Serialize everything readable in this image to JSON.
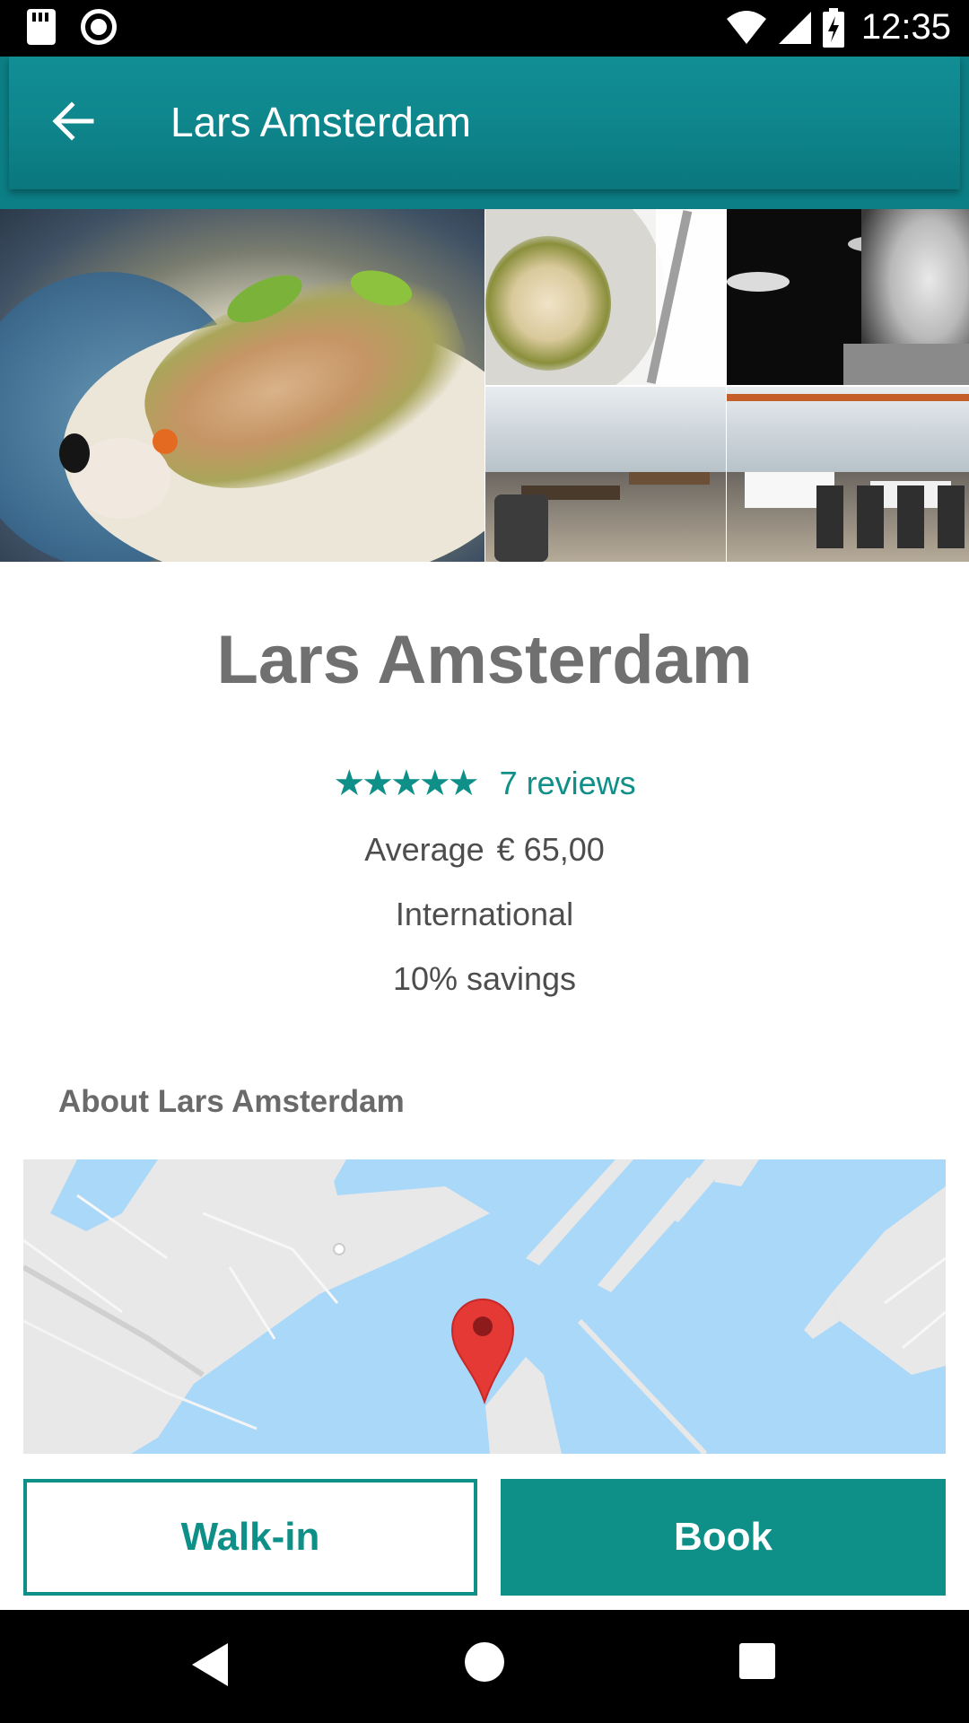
{
  "status_bar": {
    "time": "12:35",
    "icons": [
      "sd-card-icon",
      "record-icon",
      "wifi-icon",
      "signal-icon",
      "battery-charging-icon"
    ]
  },
  "app_bar": {
    "title": "Lars Amsterdam",
    "back_icon": "arrow-left-icon"
  },
  "gallery": {
    "photos": [
      "dish-photo",
      "plated-dish-photo",
      "chef-photo",
      "dining-room-photo",
      "dining-tables-photo"
    ]
  },
  "restaurant": {
    "name": "Lars Amsterdam",
    "stars": "★★★★★",
    "rating": 5,
    "reviews": "7 reviews",
    "average_label": "Average",
    "average_price": "€ 65,00",
    "cuisine": "International",
    "savings": "10% savings"
  },
  "about": {
    "heading": "About Lars Amsterdam"
  },
  "map": {
    "marker_icon": "map-pin-icon",
    "water_color": "#aad8f9",
    "land_color": "#e8e8e8",
    "marker_color": "#e53935"
  },
  "actions": {
    "walkin_label": "Walk-in",
    "book_label": "Book"
  },
  "colors": {
    "accent": "#0e8f87",
    "app_bar": "#0e868c"
  },
  "nav_bar": {
    "icons": [
      "back-triangle-icon",
      "home-circle-icon",
      "recents-square-icon"
    ]
  }
}
